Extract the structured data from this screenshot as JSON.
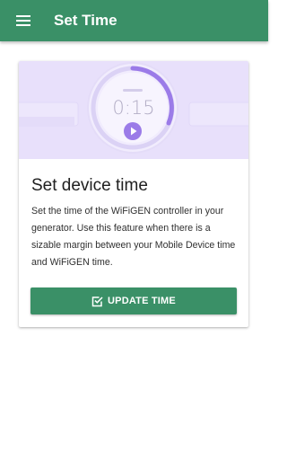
{
  "app_bar": {
    "title": "Set Time",
    "menu_icon": "menu-icon"
  },
  "card": {
    "illustration": {
      "time_display": "0:15",
      "icons": [
        "stopwatch-illustration",
        "play-icon"
      ],
      "colors": {
        "background": "#e8e0fb",
        "accent": "#9b7be8"
      }
    },
    "title": "Set device time",
    "description": "Set the time of the WiFiGEN controller in your generator. Use this feature when there is a sizable margin between your Mobile Device time and WiFiGEN time.",
    "button": {
      "label": "UPDATE TIME",
      "icon": "check-box-icon"
    }
  },
  "colors": {
    "primary": "#3a9067",
    "on_primary": "#ffffff"
  }
}
